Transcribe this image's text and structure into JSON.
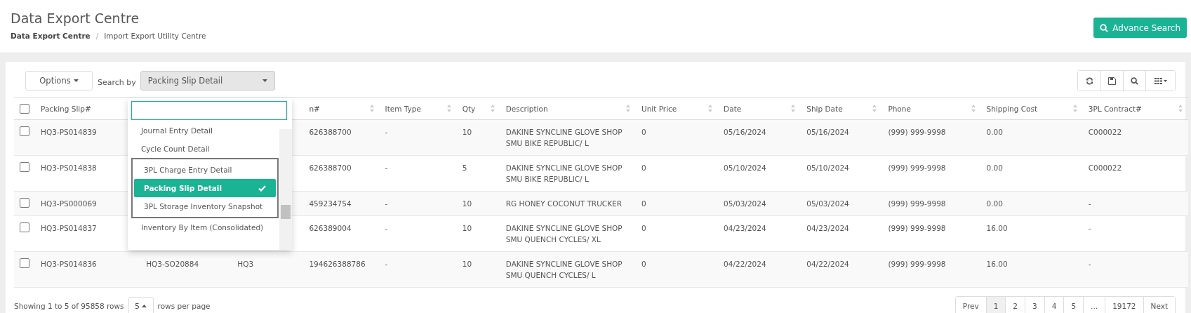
{
  "header": {
    "title": "Data Export Centre",
    "breadcrumb": [
      "Data Export Centre",
      "Import Export Utility Centre"
    ],
    "breadcrumb_separator": "/",
    "advance_search": "Advance Search"
  },
  "toolbar": {
    "options": "Options",
    "search_by_label": "Search by",
    "search_by_value": "Packing Slip Detail"
  },
  "dropdown": {
    "items": [
      {
        "label": "Journal Entry Detail",
        "selected": false,
        "outlined": false
      },
      {
        "label": "Cycle Count Detail",
        "selected": false,
        "outlined": false
      },
      {
        "label": "3PL Charge Entry Detail",
        "selected": false,
        "outlined": true
      },
      {
        "label": "Packing Slip Detail",
        "selected": true,
        "outlined": true
      },
      {
        "label": "3PL Storage Inventory Snapshot",
        "selected": false,
        "outlined": true
      },
      {
        "label": "Inventory By Item (Consolidated)",
        "selected": false,
        "outlined": false
      }
    ]
  },
  "table": {
    "header_checked": false,
    "columns": [
      {
        "label": "Packing Slip#"
      },
      {},
      {},
      {
        "label": "n#"
      },
      {
        "label": "Item Type"
      },
      {
        "label": "Qty"
      },
      {
        "label": "Description"
      },
      {
        "label": "Unit Price"
      },
      {
        "label": "Date"
      },
      {
        "label": "Ship Date"
      },
      {
        "label": "Phone"
      },
      {
        "label": "Shipping Cost"
      },
      {
        "label": "3PL Contract#"
      }
    ],
    "rows": [
      {
        "checked": false,
        "cells": [
          "HQ3-PS014839",
          "",
          "",
          "626388700",
          "-",
          "10",
          "DAKINE SYNCLINE GLOVE SHOP SMU BIKE REPUBLIC/ L",
          "0",
          "05/16/2024",
          "05/16/2024",
          "(999) 999-9998",
          "0.00",
          "C000022"
        ]
      },
      {
        "checked": false,
        "cells": [
          "HQ3-PS014838",
          "",
          "",
          "626388700",
          "-",
          "5",
          "DAKINE SYNCLINE GLOVE SHOP SMU BIKE REPUBLIC/ L",
          "0",
          "05/10/2024",
          "05/10/2024",
          "(999) 999-9998",
          "0.00",
          "C000022"
        ]
      },
      {
        "checked": false,
        "cells": [
          "HQ3-PS000069",
          "",
          "",
          "459234754",
          "-",
          "10",
          "RG HONEY COCONUT TRUCKER",
          "0",
          "05/03/2024",
          "05/03/2024",
          "(999) 999-9998",
          "0.00",
          "-"
        ]
      },
      {
        "checked": false,
        "cells": [
          "HQ3-PS014837",
          "",
          "",
          "626389004",
          "-",
          "10",
          "DAKINE SYNCLINE GLOVE SHOP SMU QUENCH CYCLES/ XL",
          "0",
          "04/23/2024",
          "04/23/2024",
          "(999) 999-9998",
          "16.00",
          "-"
        ]
      },
      {
        "checked": false,
        "cells": [
          "HQ3-PS014836",
          "HQ3-SO20884",
          "HQ3",
          "194626388786",
          "-",
          "10",
          "DAKINE SYNCLINE GLOVE SHOP SMU QUENCH CYCLES/ L",
          "0",
          "04/22/2024",
          "04/22/2024",
          "(999) 999-9998",
          "16.00",
          "-"
        ]
      }
    ]
  },
  "footer": {
    "showing": "Showing 1 to 5 of 95858 rows",
    "page_size": "5",
    "rows_per_page": "rows per page",
    "pages": [
      {
        "label": "Prev",
        "selected": false
      },
      {
        "label": "1",
        "selected": true
      },
      {
        "label": "2",
        "selected": false
      },
      {
        "label": "3",
        "selected": false
      },
      {
        "label": "4",
        "selected": false
      },
      {
        "label": "5",
        "selected": false
      },
      {
        "label": "...",
        "selected": false
      },
      {
        "label": "19172",
        "selected": false
      },
      {
        "label": "Next",
        "selected": false
      }
    ]
  }
}
